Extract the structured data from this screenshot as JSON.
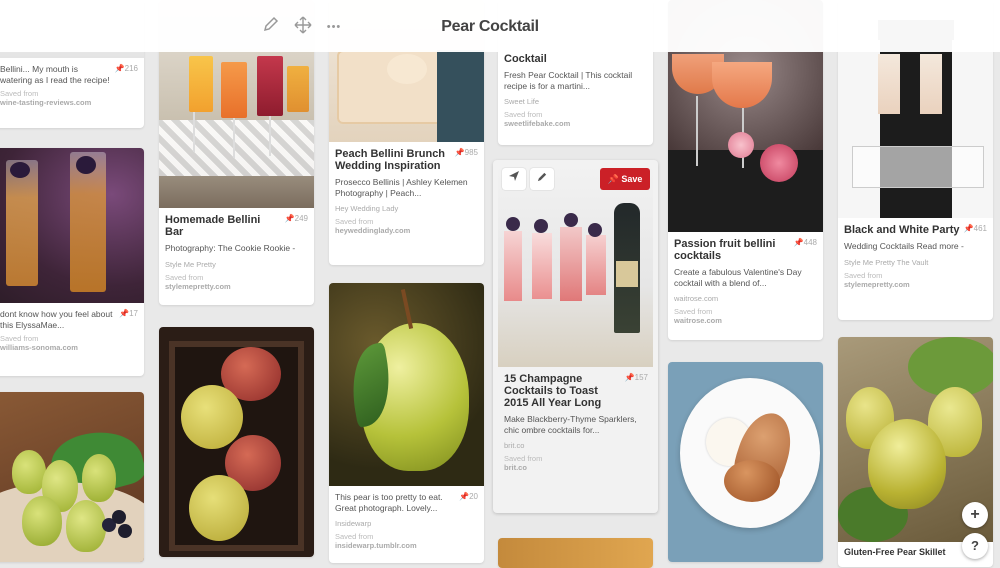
{
  "board": {
    "title": "Pear Cocktail"
  },
  "toolbar": {
    "edit_icon": "pencil-icon",
    "move_icon": "move-arrows-icon",
    "more_label": "•••"
  },
  "floating": {
    "add_label": "+",
    "help_label": "?"
  },
  "pins": {
    "c0p0": {
      "desc": "Bellini... My mouth is watering as I read the recipe!",
      "count": "216",
      "saved_from": "Saved from",
      "source": "wine-tasting-reviews.com"
    },
    "c0p1": {
      "desc": "dont know how you feel about this ElyssaMae...",
      "count": "17",
      "saved_from": "Saved from",
      "source": "williams-sonoma.com"
    },
    "c1p1": {
      "title": "Homemade Bellini Bar",
      "count": "249",
      "desc": "Photography: The Cookie Rookie -",
      "via": "Style Me Pretty",
      "saved_from": "Saved from",
      "source": "stylemepretty.com"
    },
    "c2p0": {
      "title": "Peach Bellini Brunch Wedding Inspiration",
      "count": "985",
      "desc": "Prosecco Bellinis | Ashley Kelemen Photography | Peach...",
      "via": "Hey Wedding Lady",
      "saved_from": "Saved from",
      "source": "heyweddinglady.com"
    },
    "c2p1": {
      "desc": "This pear is too pretty to eat. Great photograph. Lovely...",
      "count": "20",
      "via": "Insidewarp",
      "saved_from": "Saved from",
      "source": "insidewarp.tumblr.com"
    },
    "c3p0": {
      "title": "Cocktail",
      "desc": "Fresh Pear Cocktail | This cocktail recipe is for a martini...",
      "via": "Sweet Life",
      "saved_from": "Saved from",
      "source": "sweetlifebake.com"
    },
    "c3p1": {
      "save_label": "Save",
      "title": "15 Champagne Cocktails to Toast 2015 All Year Long",
      "count": "157",
      "desc": "Make Blackberry-Thyme Sparklers, chic ombre cocktails for...",
      "via": "brit.co",
      "saved_from": "Saved from",
      "source": "brit.co"
    },
    "c4p0": {
      "title": "Passion fruit bellini cocktails",
      "count": "448",
      "desc": "Create a fabulous Valentine's Day cocktail with a blend of...",
      "via": "waitrose.com",
      "saved_from": "Saved from",
      "source": "waitrose.com"
    },
    "c5p0": {
      "title": "Black and White Party",
      "count": "461",
      "desc": "Wedding Cocktails Read more -",
      "via": "Style Me Pretty The Vault",
      "saved_from": "Saved from",
      "source": "stylemepretty.com"
    },
    "c5p1": {
      "title": "Gluten-Free Pear Skillet"
    }
  }
}
